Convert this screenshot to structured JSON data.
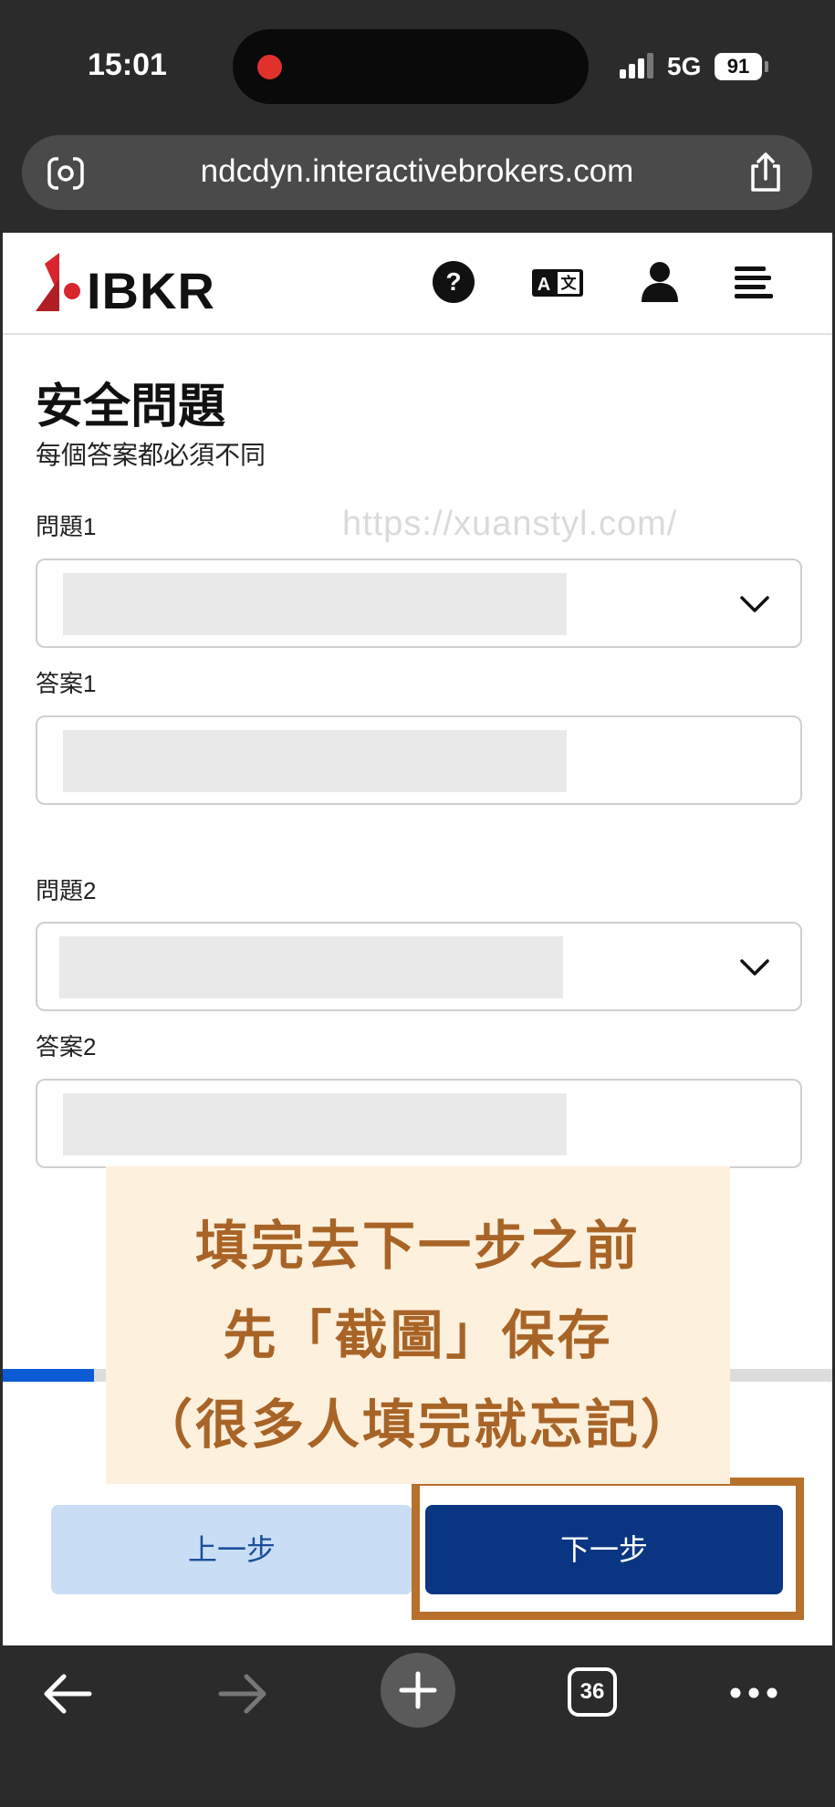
{
  "status_bar": {
    "time": "15:01",
    "network": "5G",
    "battery": "91"
  },
  "browser": {
    "url": "ndcdyn.interactivebrokers.com",
    "tab_count": "36"
  },
  "header": {
    "logo_text": "IBKR"
  },
  "form": {
    "title": "安全問題",
    "subtitle": "每個答案都必須不同",
    "watermark": "https://xuanstyl.com/",
    "question1_label": "問題1",
    "answer1_label": "答案1",
    "question2_label": "問題2",
    "answer2_label": "答案2",
    "progress": 0.11
  },
  "buttons": {
    "prev": "上一步",
    "next": "下一步"
  },
  "note": {
    "line1": "填完去下一步之前",
    "line2": "先「截圖」保存",
    "line3": "（很多人填完就忘記）"
  },
  "colors": {
    "brand_red": "#d8262e",
    "primary_button": "#0a3583",
    "secondary_button": "#c9ddf5",
    "progress": "#0d5bd4",
    "note_text": "#a86426",
    "highlight_frame": "#b8702b"
  },
  "icons": {
    "header": [
      "help-icon",
      "language-icon",
      "account-icon",
      "menu-icon"
    ],
    "toolbar": [
      "back-arrow-icon",
      "forward-arrow-icon",
      "new-tab-icon",
      "tabs-icon",
      "more-icon"
    ]
  }
}
